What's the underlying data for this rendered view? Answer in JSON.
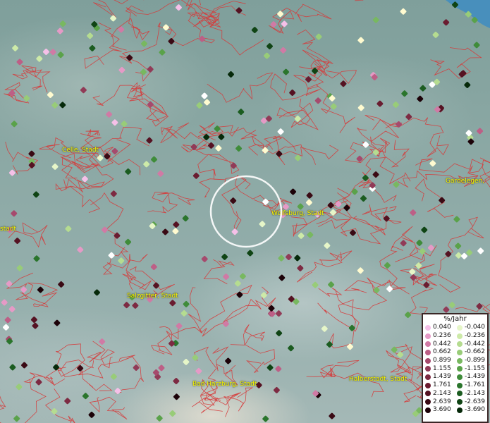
{
  "map": {
    "towns": [
      "Celle, Stadt",
      "Gardelegen,",
      "Wolfsburg, Stadt",
      "stadt",
      "Salzgitter, Stadt",
      "Bad Harzburg, Stadt",
      "Halberstadt, Stadt"
    ]
  },
  "legend": {
    "title": "%/Jahr",
    "positive": [
      "0.040",
      "0.236",
      "0.442",
      "0.662",
      "0.899",
      "1.155",
      "1.439",
      "1.761",
      "2.143",
      "2.639",
      "3.690"
    ],
    "negative": [
      "-0.040",
      "-0.236",
      "-0.442",
      "-0.662",
      "-0.899",
      "-1.155",
      "-1.439",
      "-1.761",
      "-2.143",
      "-2.639",
      "-3.690"
    ],
    "positive_colors": [
      "#f5c0e8",
      "#e59ac6",
      "#d07aa5",
      "#bd5f86",
      "#a64a6d",
      "#913b57",
      "#7d2a42",
      "#6a1c30",
      "#551222",
      "#3a0a14",
      "#1c0208"
    ],
    "negative_colors": [
      "#e6f6c8",
      "#cdeaa8",
      "#b5dc90",
      "#98cc78",
      "#78b860",
      "#5aa24a",
      "#3f8c3a",
      "#2a752c",
      "#1b5c20",
      "#0f4414",
      "#06290a"
    ]
  },
  "colors": {
    "border": "#d63a3a",
    "water": "#3e8cc2",
    "label": "#ffff00"
  }
}
